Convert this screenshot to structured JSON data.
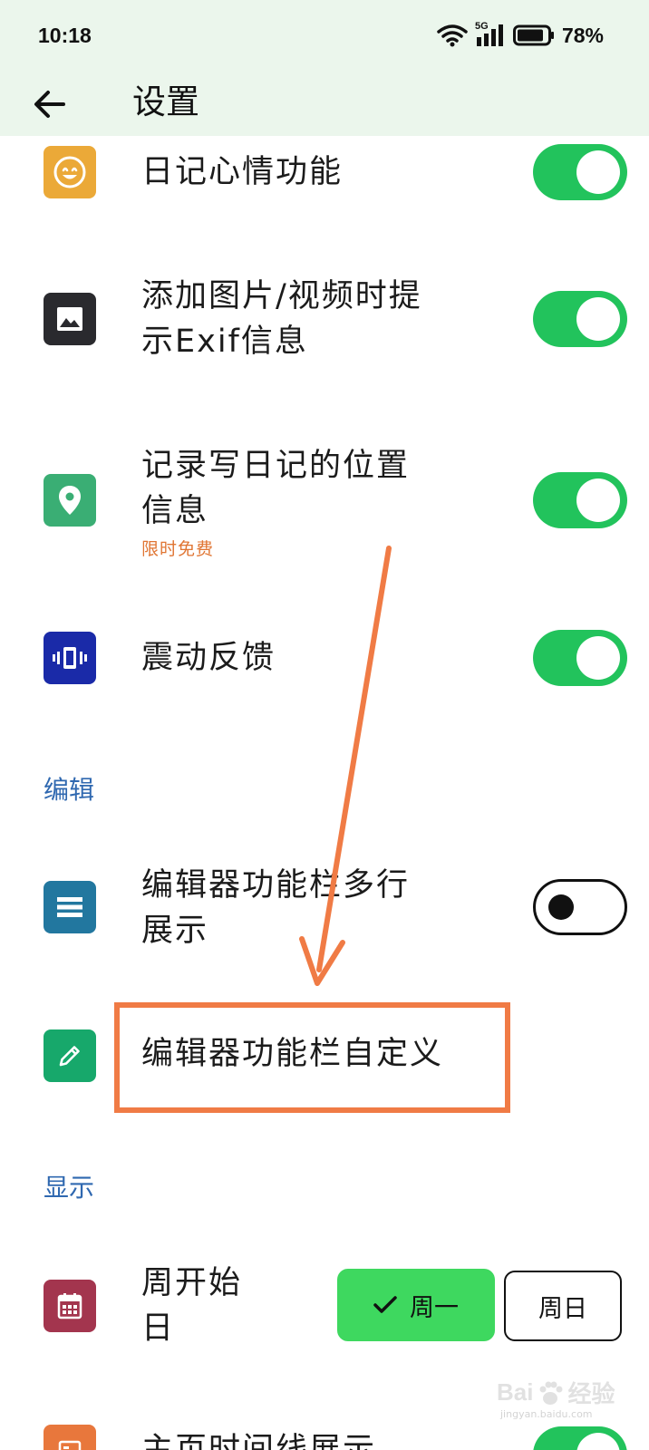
{
  "status_bar": {
    "time": "10:18",
    "network": "5G",
    "battery": "78%"
  },
  "app_bar": {
    "title": "设置",
    "back_icon": "arrow-left-icon"
  },
  "rows": [
    {
      "id": "mood",
      "icon": "smile-icon",
      "icon_color": "#eba938",
      "label": "日记心情功能",
      "toggle": "on"
    },
    {
      "id": "exif",
      "icon": "image-icon",
      "icon_color": "#2a2a2e",
      "label_lines": [
        "添加图片/视频时提",
        "示Exif信息"
      ],
      "toggle": "on"
    },
    {
      "id": "location",
      "icon": "location-pin-icon",
      "icon_color": "#3aae74",
      "label_lines": [
        "记录写日记的位置",
        "信息"
      ],
      "sub": "限时免费",
      "toggle": "on"
    },
    {
      "id": "vibration",
      "icon": "vibration-icon",
      "icon_color": "#1a2aa8",
      "label": "震动反馈",
      "toggle": "on"
    }
  ],
  "section_edit": "编辑",
  "edit_rows": [
    {
      "id": "multiline",
      "icon": "menu-lines-icon",
      "icon_color": "#22779f",
      "label_lines": [
        "编辑器功能栏多行",
        "展示"
      ],
      "toggle": "off"
    },
    {
      "id": "customize",
      "icon": "pencil-icon",
      "icon_color": "#17a86b",
      "label": "编辑器功能栏自定义"
    }
  ],
  "section_display": "显示",
  "display_rows": [
    {
      "id": "week-start",
      "icon": "calendar-icon",
      "icon_color": "#a3354e",
      "label_lines": [
        "周开始",
        "日"
      ],
      "options": [
        "周一",
        "周日"
      ],
      "selected": "周一"
    },
    {
      "id": "timeline",
      "icon": "timeline-icon",
      "icon_color": "#e8773c",
      "label": "主页时间线展示",
      "toggle": "on"
    }
  ],
  "watermark": {
    "brand": "Bai",
    "suffix": "经验",
    "sub": "jingyan.baidu.com"
  },
  "colors": {
    "header_bg": "#ebf6ec",
    "toggle_on": "#22c35c",
    "section_blue": "#2f68b0",
    "annotation": "#f07b45",
    "selected_segment": "#3ed85f"
  }
}
